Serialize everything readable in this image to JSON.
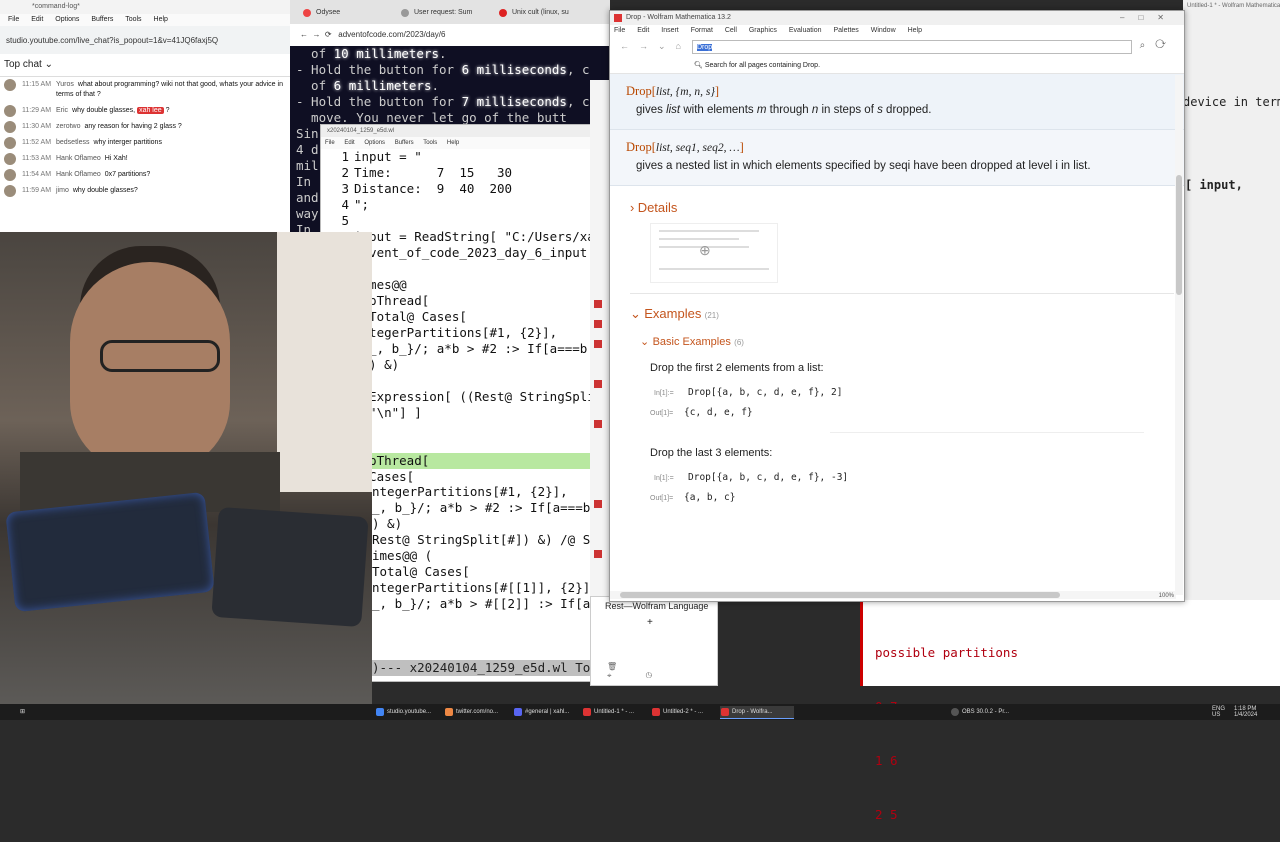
{
  "chat": {
    "window_title": "*command-log*",
    "menus": [
      "File",
      "Edit",
      "Options",
      "Buffers",
      "Tools",
      "Help"
    ],
    "url": "studio.youtube.com/live_chat?is_popout=1&v=41JQ6faxj5Q",
    "top_chat_label": "Top chat",
    "messages": [
      {
        "time": "11:15 AM",
        "author": "Yuros",
        "text": "what about programming? wiki not that good, whats your advice in terms of that ?"
      },
      {
        "time": "11:29 AM",
        "author": "Eric",
        "text": "why double glasses,",
        "highlight": "xah lee",
        "after": "?"
      },
      {
        "time": "11:30 AM",
        "author": "zerotwo",
        "text": "any reason for having 2 glass ?"
      },
      {
        "time": "11:52 AM",
        "author": "bedsetless",
        "text": "why interger partitions"
      },
      {
        "time": "11:53 AM",
        "author": "Hank Oflameo",
        "text": "Hi Xah!"
      },
      {
        "time": "11:54 AM",
        "author": "Hank Oflameo",
        "text": "0x7 partitions?"
      },
      {
        "time": "11:59 AM",
        "author": "jimo",
        "text": "why double glasses?"
      }
    ]
  },
  "browser": {
    "tabs": [
      "Odysee",
      "User request: Sum",
      "Unix cult (linux, su",
      ""
    ],
    "address": "adventofcode.com/2023/day/6",
    "lines": [
      {
        "pre": "  of ",
        "em": "10 millimeters",
        "post": "."
      },
      {
        "pre": "- Hold the button for ",
        "em": "6 milliseconds",
        "post": ", c"
      },
      {
        "pre": "  of ",
        "em": "6 millimeters",
        "post": "."
      },
      {
        "pre": "- Hold the button for ",
        "em": "7 milliseconds",
        "post": ", c"
      },
      {
        "pre": "  move. You never let go of the butt",
        "em": "",
        "post": ""
      },
      {
        "pre": "",
        "em": "",
        "post": ""
      },
      {
        "pre": "Sin",
        "em": "",
        "post": ""
      },
      {
        "pre": "4 d",
        "em": "",
        "post": ""
      },
      {
        "pre": "mil",
        "em": "",
        "post": ""
      },
      {
        "pre": "",
        "em": "",
        "post": ""
      },
      {
        "pre": "In ",
        "em": "",
        "post": ""
      },
      {
        "pre": "and",
        "em": "",
        "post": ""
      },
      {
        "pre": "way",
        "em": "",
        "post": ""
      },
      {
        "pre": "",
        "em": "",
        "post": ""
      },
      {
        "pre": "In ",
        "em": "",
        "post": ""
      },
      {
        "pre": "and",
        "em": "",
        "post": ""
      },
      {
        "pre": "way",
        "em": "",
        "post": ""
      },
      {
        "pre": "",
        "em": "",
        "post": ""
      },
      {
        "pre": "To ",
        "em": "",
        "post": ""
      },
      {
        "pre": "can",
        "em": "",
        "post": ""
      },
      {
        "pre": "val",
        "em": "",
        "post": ""
      },
      {
        "pre": "",
        "em": "",
        "post": ""
      },
      {
        "pre": "Det",
        "em": "",
        "post": ""
      },
      {
        "pre": "do ",
        "em": "",
        "post": ""
      },
      {
        "pre": "",
        "em": "",
        "post": ""
      },
      {
        "pre": "To ",
        "em": "",
        "post": ""
      }
    ]
  },
  "emacs": {
    "title": "x20240104_1259_e5d.wl",
    "menus": [
      "File",
      "Edit",
      "Options",
      "Buffers",
      "Tools",
      "Help"
    ],
    "lines": [
      {
        "n": "1",
        "t": "input = \""
      },
      {
        "n": "2",
        "t": "Time:      7  15   30"
      },
      {
        "n": "3",
        "t": "Distance:  9  40  200"
      },
      {
        "n": "4",
        "t": "\";"
      },
      {
        "n": "5",
        "t": ""
      },
      {
        "n": "6",
        "t": "input = ReadString[ \"C:/Users/xa"
      },
      {
        "n": "",
        "t": "advent_of_code_2023_day_6_input"
      },
      {
        "n": "7",
        "t": ""
      },
      {
        "n": "8",
        "t": "Times@@"
      },
      {
        "n": "9",
        "t": "MapThread["
      },
      {
        "n": "10",
        "t": "((Total@ Cases["
      },
      {
        "n": "11",
        "t": "IntegerPartitions[#1, {2}],"
      },
      {
        "n": "12",
        "t": "{a_, b_}/; a*b > #2 :> If[a===b"
      },
      {
        "n": "13",
        "t": "] ) &)"
      },
      {
        "n": "14",
        "t": ","
      },
      {
        "n": "15",
        "t": "ToExpression[ ((Rest@ StringSpli"
      },
      {
        "n": "",
        "t": "  \"\\n\"] ]"
      },
      {
        "n": "16",
        "t": "]"
      },
      {
        "n": "17",
        "t": ""
      },
      {
        "n": "18",
        "t": "MapThread[",
        "cur": true
      },
      {
        "n": "19",
        "t": "((Cases["
      }
    ],
    "below": [
      "ntegerPartitions[#1, {2}],",
      "_, b_}/; a*b > #2 :> If[a===b",
      ") &)",
      "",
      "Rest@ StringSplit[#]) &) /@ S",
      "",
      "",
      "imes@@ (",
      "Total@ Cases[",
      "ntegerPartitions[#[[1]], {2}],",
      "_, b_}/; a*b > #[[2]] :> If[a"
    ],
    "modeline": ")--- x20240104_1259_e5d.wl To"
  },
  "doc": {
    "window_title": "Drop - Wolfram Mathematica 13.2",
    "menus": [
      "File",
      "Edit",
      "Insert",
      "Format",
      "Cell",
      "Graphics",
      "Evaluation",
      "Palettes",
      "Window",
      "Help"
    ],
    "search_value": "Drop",
    "search_all": "Search for all pages containing Drop.",
    "usage1": {
      "fn": "Drop",
      "args": "list, {m, n, s}",
      "desc_a": "gives",
      "desc_b": "list",
      "desc_c": "with elements",
      "desc_d": "m",
      "desc_e": "through",
      "desc_f": "n",
      "desc_g": "in steps of",
      "desc_h": "s",
      "desc_i": "dropped."
    },
    "usage2": {
      "fn": "Drop",
      "args": "list, seq1, seq2, …",
      "desc": "gives a nested list in which elements specified by seqi have been dropped at level i in list."
    },
    "details_label": "Details",
    "examples_label": "Examples",
    "examples_count": "(21)",
    "basic_label": "Basic Examples",
    "basic_count": "(6)",
    "ex1_text": "Drop the first 2 elements from a list:",
    "ex1_in": "Drop[{a, b, c, d, e, f}, 2]",
    "ex1_out": "{c, d, e, f}",
    "ex2_text": "Drop the last 3 elements:",
    "ex2_in": "Drop[{a, b, c, d, e, f}, -3]",
    "ex2_out": "{a, b, c}",
    "in_label": "In[1]:=",
    "out_label": "Out[1]=",
    "zoom": "100%"
  },
  "rest_panel": {
    "label": "Rest—Wolfram Language"
  },
  "bg_window": {
    "title": "Untitled-1 * - Wolfram Mathematica 13.2",
    "snippet": "[ input,",
    "device_text": "device in terms of th"
  },
  "partitions": [
    "possible partitions",
    "0 7",
    "1 6",
    "2 5"
  ],
  "taskbar": {
    "items": [
      "studio.youtube...",
      "twitter.com/no...",
      "#general | xahl...",
      "Untitled-1 * - ...",
      "Untitled-2 * - ...",
      "Drop - Wolfra...",
      "OBS 30.0.2 - Pr..."
    ],
    "lang": "ENG\nUS",
    "time": "1:18 PM",
    "date": "1/4/2024"
  }
}
